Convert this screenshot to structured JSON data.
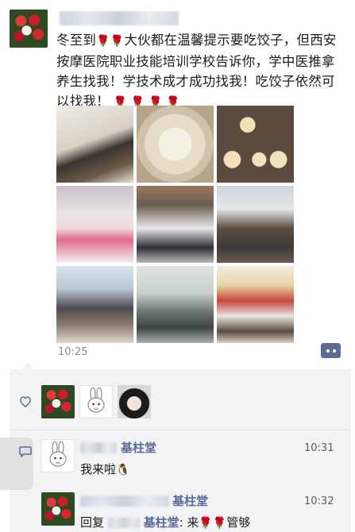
{
  "post": {
    "text_parts": [
      "冬至到",
      "大伙都在温馨提示要吃饺子，但西安按摩医院职业技能培训学校告诉你，学中医推拿养生找我！学技术成才成功找我！吃饺子依然可以找我！"
    ],
    "timestamp": "10:25"
  },
  "comments": [
    {
      "name": "基柱堂",
      "text": "我来啦",
      "time": "10:31"
    },
    {
      "name": "基柱堂",
      "reply_label": "回复",
      "text_before": ": 来",
      "text_after": "管够",
      "time": "10:32"
    }
  ],
  "icons": {
    "like": "heart-icon",
    "comment": "comment-icon",
    "rose": "rose-emoji",
    "penguin": "penguin-emoji"
  },
  "colors": {
    "name_link": "#576b95",
    "panel_bg": "#f3f3f5"
  }
}
